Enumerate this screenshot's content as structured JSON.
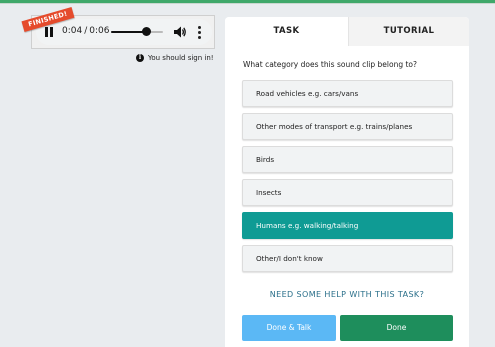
{
  "player": {
    "ribbon_label": "FINISHED!",
    "current_time": "0:04",
    "separator": "/",
    "duration": "0:06",
    "progress_fraction": 0.667,
    "pause_icon": "pause-icon",
    "volume_icon": "volume-icon",
    "more_icon": "more-vertical-icon"
  },
  "signin": {
    "icon": "info-icon",
    "icon_glyph": "i",
    "text": "You should sign in!"
  },
  "tabs": [
    {
      "label": "TASK",
      "active": true
    },
    {
      "label": "TUTORIAL",
      "active": false
    }
  ],
  "task": {
    "question": "What category does this sound clip belong to?",
    "options": [
      {
        "label": "Road vehicles e.g. cars/vans",
        "selected": false
      },
      {
        "label": "Other modes of transport e.g. trains/planes",
        "selected": false
      },
      {
        "label": "Birds",
        "selected": false
      },
      {
        "label": "Insects",
        "selected": false
      },
      {
        "label": "Humans e.g. walking/talking",
        "selected": true
      },
      {
        "label": "Other/I don't know",
        "selected": false
      }
    ],
    "help_link": "NEED SOME HELP WITH THIS TASK?",
    "buttons": {
      "done_talk": "Done & Talk",
      "done": "Done"
    }
  },
  "colors": {
    "selected_option": "#0f9b94",
    "done_button": "#1e8e5c",
    "done_talk_button": "#5bb8f5",
    "ribbon": "#e54b2c",
    "help_link": "#2a6f8a"
  }
}
